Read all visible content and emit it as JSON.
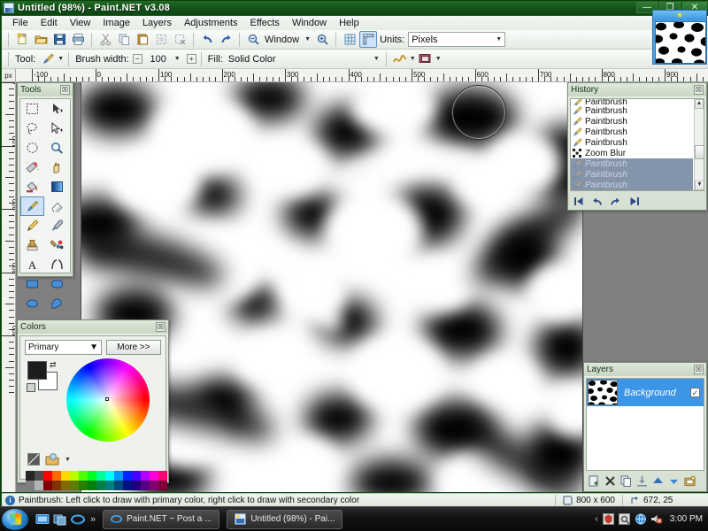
{
  "window": {
    "title": "Untitled (98%) - Paint.NET v3.08",
    "icon": "paintnet-icon",
    "minimize_label": "—",
    "maximize_label": "❐",
    "close_label": "✕"
  },
  "menubar": {
    "items": [
      {
        "label": "File"
      },
      {
        "label": "Edit"
      },
      {
        "label": "View"
      },
      {
        "label": "Image"
      },
      {
        "label": "Layers"
      },
      {
        "label": "Adjustments"
      },
      {
        "label": "Effects"
      },
      {
        "label": "Window"
      },
      {
        "label": "Help"
      }
    ]
  },
  "main_toolbar": {
    "buttons": [
      {
        "name": "new-icon",
        "glyph": "὜E"
      },
      {
        "name": "open-icon",
        "glyph": "Ὄ2"
      },
      {
        "name": "save-icon",
        "glyph": "ὋE"
      },
      {
        "name": "print-icon",
        "glyph": "὚8"
      },
      {
        "name": "cut-icon",
        "glyph": "✂"
      },
      {
        "name": "copy-icon",
        "glyph": "⧉"
      },
      {
        "name": "paste-icon",
        "glyph": "ὌB"
      },
      {
        "name": "crop-to-selection-icon",
        "glyph": "⛶"
      },
      {
        "name": "deselect-all-icon",
        "glyph": "⌧"
      },
      {
        "name": "undo-icon",
        "glyph": "↶"
      },
      {
        "name": "redo-icon",
        "glyph": "↷"
      },
      {
        "name": "zoom-out-icon",
        "glyph": "ὐD"
      },
      {
        "name": "zoom-in-icon",
        "glyph": "ὐE"
      },
      {
        "name": "grid-icon",
        "glyph": "▦"
      },
      {
        "name": "rulers-icon",
        "glyph": "ὌF"
      }
    ],
    "zoom_value": "Window",
    "units_label": "Units:",
    "units_value": "Pixels"
  },
  "tool_toolbar": {
    "tool_label": "Tool:",
    "tool_value": "paintbrush-icon",
    "brush_width_label": "Brush width:",
    "brush_width_value": "100",
    "decrease_label": "−",
    "increase_label": "+",
    "fill_label": "Fill:",
    "fill_value": "Solid Color",
    "blend_name": "antialiasing-icon",
    "color_mode_name": "blend-mode-icon"
  },
  "rulers": {
    "unit_corner": "px",
    "h_labels": [
      "-100",
      "0",
      "100",
      "200",
      "300",
      "400",
      "500",
      "600",
      "700",
      "800",
      "900"
    ],
    "v_labels": [
      "0",
      "100",
      "200",
      "300",
      "400"
    ]
  },
  "tools_palette": {
    "title": "Tools",
    "close_label": "☒",
    "selected_index": 10,
    "items": [
      {
        "name": "rectangle-select-tool",
        "glyph": "rect-select"
      },
      {
        "name": "move-selected-tool",
        "glyph": "move-selected"
      },
      {
        "name": "lasso-select-tool",
        "glyph": "lasso"
      },
      {
        "name": "move-selection-tool",
        "glyph": "move-selection"
      },
      {
        "name": "ellipse-select-tool",
        "glyph": "ellipse-select"
      },
      {
        "name": "zoom-tool",
        "glyph": "magnifier"
      },
      {
        "name": "magic-wand-tool",
        "glyph": "magic-wand"
      },
      {
        "name": "pan-tool",
        "glyph": "hand"
      },
      {
        "name": "paint-bucket-tool",
        "glyph": "bucket"
      },
      {
        "name": "gradient-tool",
        "glyph": "gradient"
      },
      {
        "name": "paintbrush-tool",
        "glyph": "paintbrush"
      },
      {
        "name": "eraser-tool",
        "glyph": "eraser"
      },
      {
        "name": "pencil-tool",
        "glyph": "pencil"
      },
      {
        "name": "color-picker-tool",
        "glyph": "eyedropper"
      },
      {
        "name": "clone-stamp-tool",
        "glyph": "stamp"
      },
      {
        "name": "recolor-tool",
        "glyph": "recolor"
      },
      {
        "name": "text-tool",
        "glyph": "text"
      },
      {
        "name": "line-curve-tool",
        "glyph": "line-curve"
      },
      {
        "name": "rectangle-tool",
        "glyph": "rectangle"
      },
      {
        "name": "rounded-rectangle-tool",
        "glyph": "rounded-rect"
      },
      {
        "name": "ellipse-tool",
        "glyph": "ellipse"
      },
      {
        "name": "freeform-shape-tool",
        "glyph": "freeform"
      }
    ]
  },
  "history_palette": {
    "title": "History",
    "close_label": "☒",
    "entries": [
      {
        "label": "Paintbrush",
        "state": "done",
        "clipped": true
      },
      {
        "label": "Paintbrush",
        "state": "done"
      },
      {
        "label": "Paintbrush",
        "state": "done"
      },
      {
        "label": "Paintbrush",
        "state": "done"
      },
      {
        "label": "Paintbrush",
        "state": "done"
      },
      {
        "label": "Zoom Blur",
        "state": "done"
      },
      {
        "label": "Paintbrush",
        "state": "undone"
      },
      {
        "label": "Paintbrush",
        "state": "undone"
      },
      {
        "label": "Paintbrush",
        "state": "undone"
      }
    ],
    "buttons": [
      {
        "name": "rewind-to-start-button",
        "glyph": "⏮"
      },
      {
        "name": "undo-button",
        "glyph": "↶"
      },
      {
        "name": "redo-button",
        "glyph": "↷"
      },
      {
        "name": "fast-forward-to-end-button",
        "glyph": "⏭"
      }
    ]
  },
  "colors_palette": {
    "title": "Colors",
    "close_label": "☒",
    "mode_value": "Primary",
    "more_label": "More >>",
    "primary_color": "#1c1c1c",
    "secondary_color": "#ffffff",
    "swap_label": "⇄",
    "palette_row1": [
      "#262626",
      "#4d4d4d",
      "#ff0000",
      "#ff6a00",
      "#ffd800",
      "#b6ff00",
      "#4cff00",
      "#00ff21",
      "#00ff90",
      "#00ffff",
      "#0094ff",
      "#0026ff",
      "#4800ff",
      "#b200ff",
      "#ff00dc",
      "#ff006e"
    ],
    "palette_row2": [
      "#7f7f7f",
      "#b2b2b2",
      "#7f0000",
      "#7f3300",
      "#7f6a00",
      "#5b7f00",
      "#267f00",
      "#007f0e",
      "#007f46",
      "#007f7f",
      "#004a7f",
      "#00137f",
      "#21007f",
      "#57007f",
      "#7f006e",
      "#7f0037"
    ]
  },
  "layers_palette": {
    "title": "Layers",
    "close_label": "☒",
    "layers": [
      {
        "name": "Background",
        "visible": true,
        "check_glyph": "✓"
      }
    ],
    "buttons": [
      {
        "name": "add-layer-button",
        "glyph": "➕"
      },
      {
        "name": "delete-layer-button",
        "glyph": "✕"
      },
      {
        "name": "duplicate-layer-button",
        "glyph": "⧉"
      },
      {
        "name": "merge-layer-down-button",
        "glyph": "⤓"
      },
      {
        "name": "move-layer-up-button",
        "glyph": "▲"
      },
      {
        "name": "move-layer-down-button",
        "glyph": "▼"
      },
      {
        "name": "layer-properties-button",
        "glyph": "⚙"
      }
    ]
  },
  "canvas": {
    "zoom": "98%",
    "brush_cursor_size": 62,
    "image_description": "zoom-blurred black and white blob pattern"
  },
  "statusbar": {
    "info_icon": "i",
    "hint": "Paintbrush: Left click to draw with primary color, right click to draw with secondary color",
    "image_size": "800 x 600",
    "cursor_position": "672, 25",
    "size_icon": "image-size-icon",
    "position_icon": "cursor-position-icon"
  },
  "navigator": {
    "star_icon": "★"
  },
  "taskbar": {
    "start_label": "start-orb",
    "quicklaunch": [
      {
        "name": "show-desktop-icon",
        "color": "#3b7fd4"
      },
      {
        "name": "flip-3d-icon",
        "color": "#2f6aa8"
      },
      {
        "name": "internet-explorer-icon",
        "color": "#45a0e6"
      }
    ],
    "overflow_label": "»",
    "tasks": [
      {
        "label": "Paint.NET ~ Post a ...",
        "icon": "internet-explorer-icon"
      },
      {
        "label": "Untitled (98%) - Pai...",
        "icon": "paintnet-icon"
      }
    ],
    "tray_expand": "‹",
    "tray_icons": [
      {
        "name": "security-tray-icon",
        "color": "#c0392b"
      },
      {
        "name": "settings-tray-icon",
        "color": "#888888"
      },
      {
        "name": "network-tray-icon",
        "color": "#2f7fd1"
      },
      {
        "name": "volume-tray-icon",
        "color": "#bb2222"
      }
    ],
    "clock": "3:00 PM"
  },
  "colors": {
    "title_bar": "#14521a",
    "desktop": "#0a3d0a",
    "selection_blue": "#3d95e8",
    "canvas_bg": "#808080"
  }
}
